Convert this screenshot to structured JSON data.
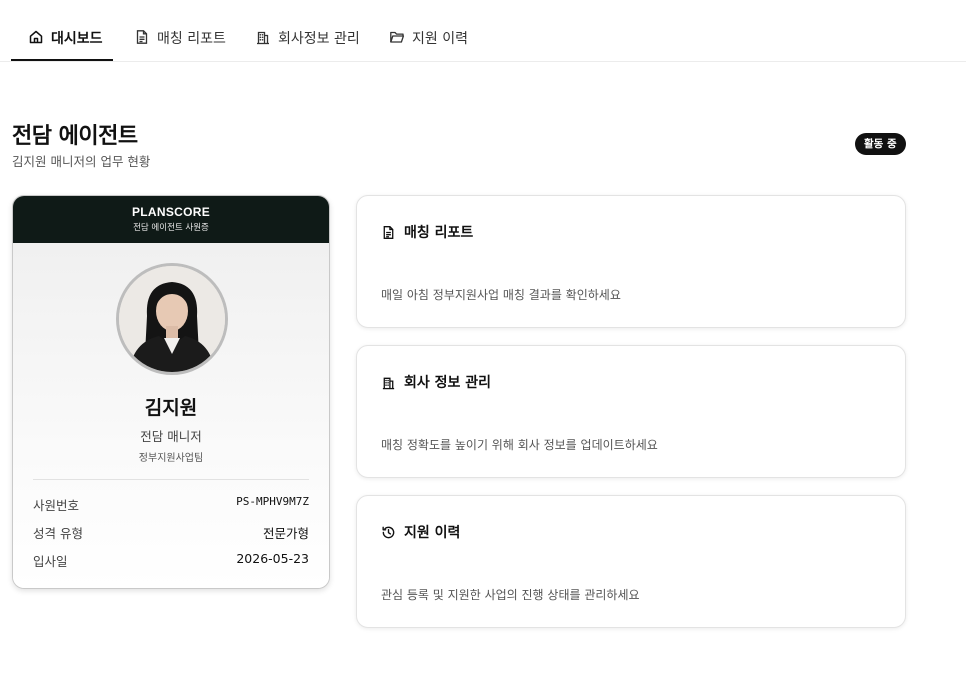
{
  "nav": {
    "tabs": [
      {
        "label": "대시보드",
        "icon": "home-icon",
        "active": true
      },
      {
        "label": "매칭 리포트",
        "icon": "document-icon",
        "active": false
      },
      {
        "label": "회사정보 관리",
        "icon": "building-icon",
        "active": false
      },
      {
        "label": "지원 이력",
        "icon": "folder-icon",
        "active": false
      }
    ]
  },
  "header": {
    "title": "전담 에이전트",
    "subtitle": "김지원 매니저의 업무 현황",
    "status": "활동 중"
  },
  "id_card": {
    "brand": "PLANSCORE",
    "brand_sub": "전담 에이전트 사원증",
    "name": "김지원",
    "role": "전담 매니저",
    "team": "정부지원사업팀",
    "rows": [
      {
        "label": "사원번호",
        "value": "PS-MPHV9M7Z"
      },
      {
        "label": "성격 유형",
        "value": "전문가형"
      },
      {
        "label": "입사일",
        "value": "2026-05-23"
      }
    ]
  },
  "features": [
    {
      "title": "매칭 리포트",
      "icon": "document-icon",
      "description": "매일 아침 정부지원사업 매칭 결과를 확인하세요"
    },
    {
      "title": "회사 정보 관리",
      "icon": "building-icon",
      "description": "매칭 정확도를 높이기 위해 회사 정보를 업데이트하세요"
    },
    {
      "title": "지원 이력",
      "icon": "history-icon",
      "description": "관심 등록 및 지원한 사업의 진행 상태를 관리하세요"
    }
  ],
  "colors": {
    "accent": "#111111",
    "card_header": "#0f1a17"
  }
}
